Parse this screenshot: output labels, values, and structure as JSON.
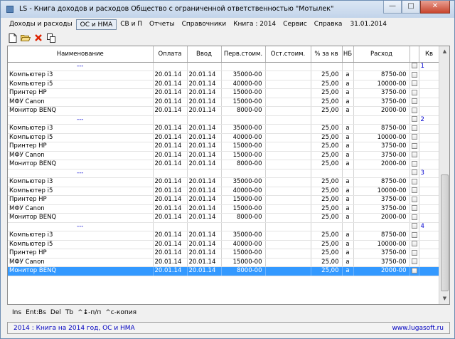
{
  "window": {
    "title": "LS - Книга доходов и расходов   Общество с ограниченной ответственностью \"Мотылек\"",
    "minimize_glyph": "—",
    "maximize_glyph": "□",
    "close_glyph": "✕"
  },
  "menu": {
    "items": [
      "Доходы и расходы",
      "ОС и НМА",
      "СВ и П",
      "Отчеты",
      "Справочники",
      "Книга : 2014",
      "Сервис",
      "Справка"
    ],
    "active_index": 1,
    "date": "31.01.2014"
  },
  "toolbar": {
    "icons": [
      "new-document-icon",
      "open-folder-icon",
      "delete-icon",
      "copy-icon"
    ],
    "delete_color": "#dd2200"
  },
  "table": {
    "columns": [
      "Наименование",
      "Оплата",
      "Ввод",
      "Перв.стоим.",
      "Ост.стоим.",
      "% за кв",
      "НБ",
      "Расход",
      "",
      "Кв"
    ],
    "rows": [
      {
        "type": "group",
        "quarter": "1"
      },
      {
        "name": "Компьютер i3",
        "pay": "20.01.14",
        "input": "20.01.14",
        "initial": "35000-00",
        "residual": "",
        "percent": "25,00",
        "nb": "a",
        "expense": "8750-00"
      },
      {
        "name": "Компьютер i5",
        "pay": "20.01.14",
        "input": "20.01.14",
        "initial": "40000-00",
        "residual": "",
        "percent": "25,00",
        "nb": "a",
        "expense": "10000-00"
      },
      {
        "name": "Принтер HP",
        "pay": "20.01.14",
        "input": "20.01.14",
        "initial": "15000-00",
        "residual": "",
        "percent": "25,00",
        "nb": "a",
        "expense": "3750-00"
      },
      {
        "name": "МФУ Canon",
        "pay": "20.01.14",
        "input": "20.01.14",
        "initial": "15000-00",
        "residual": "",
        "percent": "25,00",
        "nb": "a",
        "expense": "3750-00"
      },
      {
        "name": "Монитор BENQ",
        "pay": "20.01.14",
        "input": "20.01.14",
        "initial": "8000-00",
        "residual": "",
        "percent": "25,00",
        "nb": "a",
        "expense": "2000-00"
      },
      {
        "type": "group",
        "quarter": "2"
      },
      {
        "name": "Компьютер i3",
        "pay": "20.01.14",
        "input": "20.01.14",
        "initial": "35000-00",
        "residual": "",
        "percent": "25,00",
        "nb": "a",
        "expense": "8750-00"
      },
      {
        "name": "Компьютер i5",
        "pay": "20.01.14",
        "input": "20.01.14",
        "initial": "40000-00",
        "residual": "",
        "percent": "25,00",
        "nb": "a",
        "expense": "10000-00"
      },
      {
        "name": "Принтер HP",
        "pay": "20.01.14",
        "input": "20.01.14",
        "initial": "15000-00",
        "residual": "",
        "percent": "25,00",
        "nb": "a",
        "expense": "3750-00"
      },
      {
        "name": "МФУ Canon",
        "pay": "20.01.14",
        "input": "20.01.14",
        "initial": "15000-00",
        "residual": "",
        "percent": "25,00",
        "nb": "a",
        "expense": "3750-00"
      },
      {
        "name": "Монитор BENQ",
        "pay": "20.01.14",
        "input": "20.01.14",
        "initial": "8000-00",
        "residual": "",
        "percent": "25,00",
        "nb": "a",
        "expense": "2000-00"
      },
      {
        "type": "group",
        "quarter": "3"
      },
      {
        "name": "Компьютер i3",
        "pay": "20.01.14",
        "input": "20.01.14",
        "initial": "35000-00",
        "residual": "",
        "percent": "25,00",
        "nb": "a",
        "expense": "8750-00"
      },
      {
        "name": "Компьютер i5",
        "pay": "20.01.14",
        "input": "20.01.14",
        "initial": "40000-00",
        "residual": "",
        "percent": "25,00",
        "nb": "a",
        "expense": "10000-00"
      },
      {
        "name": "Принтер HP",
        "pay": "20.01.14",
        "input": "20.01.14",
        "initial": "15000-00",
        "residual": "",
        "percent": "25,00",
        "nb": "a",
        "expense": "3750-00"
      },
      {
        "name": "МФУ Canon",
        "pay": "20.01.14",
        "input": "20.01.14",
        "initial": "15000-00",
        "residual": "",
        "percent": "25,00",
        "nb": "a",
        "expense": "3750-00"
      },
      {
        "name": "Монитор BENQ",
        "pay": "20.01.14",
        "input": "20.01.14",
        "initial": "8000-00",
        "residual": "",
        "percent": "25,00",
        "nb": "a",
        "expense": "2000-00"
      },
      {
        "type": "group",
        "quarter": "4"
      },
      {
        "name": "Компьютер i3",
        "pay": "20.01.14",
        "input": "20.01.14",
        "initial": "35000-00",
        "residual": "",
        "percent": "25,00",
        "nb": "a",
        "expense": "8750-00"
      },
      {
        "name": "Компьютер i5",
        "pay": "20.01.14",
        "input": "20.01.14",
        "initial": "40000-00",
        "residual": "",
        "percent": "25,00",
        "nb": "a",
        "expense": "10000-00"
      },
      {
        "name": "Принтер HP",
        "pay": "20.01.14",
        "input": "20.01.14",
        "initial": "15000-00",
        "residual": "",
        "percent": "25,00",
        "nb": "a",
        "expense": "3750-00"
      },
      {
        "name": "МФУ Canon",
        "pay": "20.01.14",
        "input": "20.01.14",
        "initial": "15000-00",
        "residual": "",
        "percent": "25,00",
        "nb": "a",
        "expense": "3750-00"
      },
      {
        "name": "Монитор BENQ",
        "pay": "20.01.14",
        "input": "20.01.14",
        "initial": "8000-00",
        "residual": "",
        "percent": "25,00",
        "nb": "a",
        "expense": "2000-00",
        "selected": true
      }
    ],
    "group_marker": "---"
  },
  "hints": [
    "Ins",
    "Ent:Bs",
    "Del",
    "Tb",
    "^↨-п/п",
    "^c-копия"
  ],
  "status": {
    "left": "2014 : Книга на 2014 год, ОС и НМА",
    "right": "www.lugasoft.ru"
  },
  "colors": {
    "selection": "#3399ff",
    "link_blue": "#0000c0"
  }
}
